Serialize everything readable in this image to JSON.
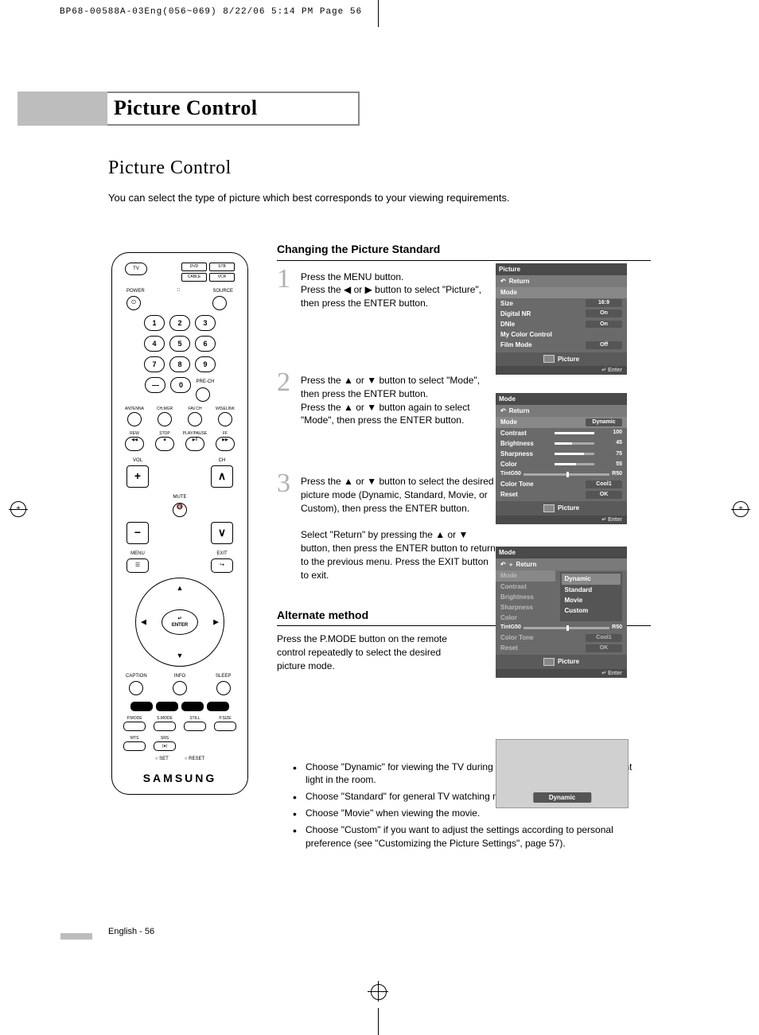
{
  "header_crop": "BP68-00588A-03Eng(056~069)  8/22/06  5:14 PM  Page 56",
  "title": "Picture Control",
  "subtitle": "Picture Control",
  "intro": "You can select the type of picture which best corresponds to your viewing requirements.",
  "section1_heading": "Changing the Picture Standard",
  "steps": [
    {
      "num": "1",
      "text": "Press the MENU button.\nPress the ◀ or ▶ button to select \"Picture\", then press the ENTER button."
    },
    {
      "num": "2",
      "text": "Press the ▲ or ▼ button to select \"Mode\", then press the ENTER button.\nPress the ▲ or ▼ button again to select \"Mode\", then press the ENTER button."
    },
    {
      "num": "3",
      "text": "Press the ▲ or ▼ button to select the desired picture mode (Dynamic, Standard, Movie, or Custom), then press the ENTER button.\n\nSelect \"Return\" by pressing the ▲ or ▼ button, then press the ENTER button to return to the previous menu. Press the EXIT button to exit."
    }
  ],
  "alt_heading": "Alternate method",
  "alt_text": "Press the P.MODE button on the remote control repeatedly to select the desired picture mode.",
  "bullets": [
    "Choose \"Dynamic\" for viewing the TV during the day or when there is a bright light in the room.",
    "Choose \"Standard\" for general TV watching mode.",
    "Choose \"Movie\" when viewing the movie.",
    "Choose \"Custom\" if you want to adjust the settings according to personal preference (see \"Customizing the Picture Settings\", page 57)."
  ],
  "page_footer": "English - 56",
  "osd1": {
    "title": "Picture",
    "return": "Return",
    "rows": [
      {
        "k": "Mode",
        "v": ""
      },
      {
        "k": "Size",
        "v": "16:9"
      },
      {
        "k": "Digital NR",
        "v": "On"
      },
      {
        "k": "DNIe",
        "v": "On"
      },
      {
        "k": "My Color Control",
        "v": ""
      },
      {
        "k": "Film Mode",
        "v": "Off"
      }
    ],
    "foot": "Picture",
    "hint": "Enter"
  },
  "osd2": {
    "title": "Mode",
    "return": "Return",
    "rows": [
      {
        "k": "Mode",
        "v": "Dynamic"
      },
      {
        "k": "Contrast",
        "s": 100,
        "n": "100"
      },
      {
        "k": "Brightness",
        "s": 45,
        "n": "45"
      },
      {
        "k": "Sharpness",
        "s": 75,
        "n": "75"
      },
      {
        "k": "Color",
        "s": 55,
        "n": "55"
      }
    ],
    "tint": {
      "k": "Tint",
      "l": "G50",
      "r": "R50"
    },
    "rows2": [
      {
        "k": "Color Tone",
        "v": "Cool1"
      },
      {
        "k": "Reset",
        "v": "OK"
      }
    ],
    "foot": "Picture",
    "hint": "Enter"
  },
  "osd3": {
    "title": "Mode",
    "return": "Return",
    "left": [
      "Mode",
      "Contrast",
      "Brightness",
      "Sharpness",
      "Color"
    ],
    "options": [
      "Dynamic",
      "Standard",
      "Movie",
      "Custom"
    ],
    "tint": {
      "k": "Tint",
      "l": "G50",
      "r": "R50"
    },
    "rows2": [
      {
        "k": "Color Tone",
        "v": "Cool1"
      },
      {
        "k": "Reset",
        "v": "OK"
      }
    ],
    "foot": "Picture",
    "hint": "Enter"
  },
  "screen_tag": "Dynamic",
  "remote": {
    "brand": "SAMSUNG",
    "top_labels": [
      "DVD",
      "STB",
      "CABLE",
      "VCR"
    ],
    "tv": "TV",
    "power": "POWER",
    "source": "SOURCE",
    "nums": [
      "1",
      "2",
      "3",
      "4",
      "5",
      "6",
      "7",
      "8",
      "9",
      "0"
    ],
    "dash": "—",
    "prech": "PRE-CH",
    "row_labels": [
      "ANTENNA",
      "CH.MGR",
      "FAV.CH",
      "WISELINK"
    ],
    "transport": [
      "REW",
      "STOP",
      "PLAY/PAUSE",
      "FF"
    ],
    "vol": "VOL",
    "ch": "CH",
    "mute": "MUTE",
    "menu": "MENU",
    "exit": "EXIT",
    "enter": "ENTER",
    "bottom1": [
      "CAPTION",
      "INFO",
      "SLEEP"
    ],
    "bottom2": [
      "P.MODE",
      "S.MODE",
      "STILL",
      "P.SIZE"
    ],
    "bottom3": [
      "MTS",
      "SRS"
    ],
    "bottom4": [
      "SET",
      "RESET"
    ]
  }
}
